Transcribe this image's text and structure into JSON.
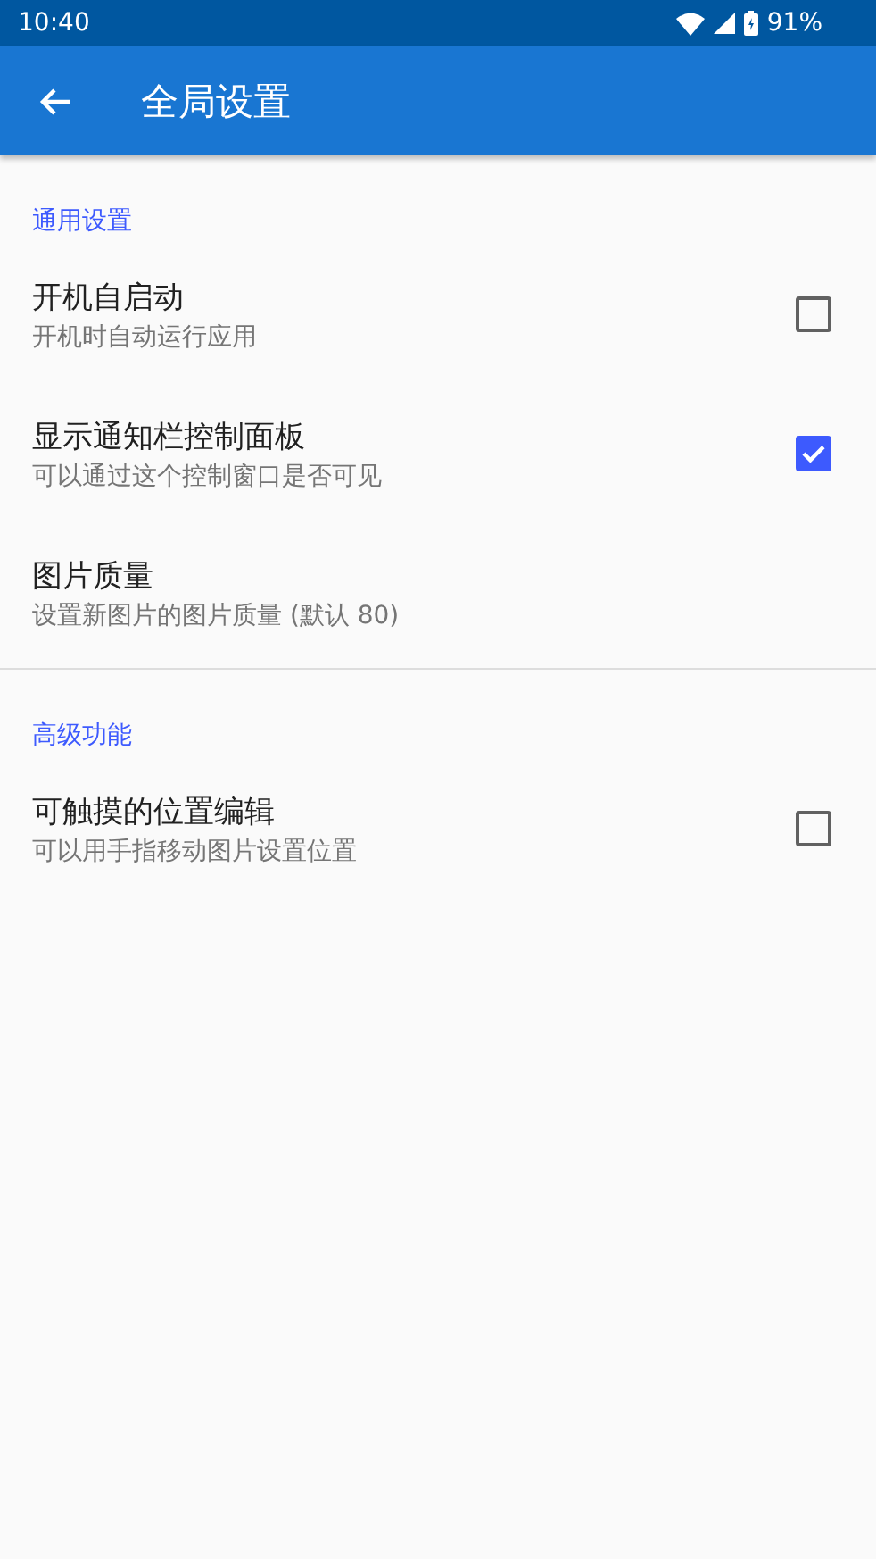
{
  "status_bar": {
    "time": "10:40",
    "battery": "91%"
  },
  "app_bar": {
    "title": "全局设置"
  },
  "sections": [
    {
      "title": "通用设置",
      "items": [
        {
          "kind": "checkbox",
          "title": "开机自启动",
          "summary": "开机时自动运行应用",
          "checked": false
        },
        {
          "kind": "checkbox",
          "title": "显示通知栏控制面板",
          "summary": "可以通过这个控制窗口是否可见",
          "checked": true
        },
        {
          "kind": "plain",
          "title": "图片质量",
          "summary": "设置新图片的图片质量 (默认 80)"
        }
      ]
    },
    {
      "title": "高级功能",
      "items": [
        {
          "kind": "checkbox",
          "title": "可触摸的位置编辑",
          "summary": "可以用手指移动图片设置位置",
          "checked": false
        }
      ]
    }
  ]
}
